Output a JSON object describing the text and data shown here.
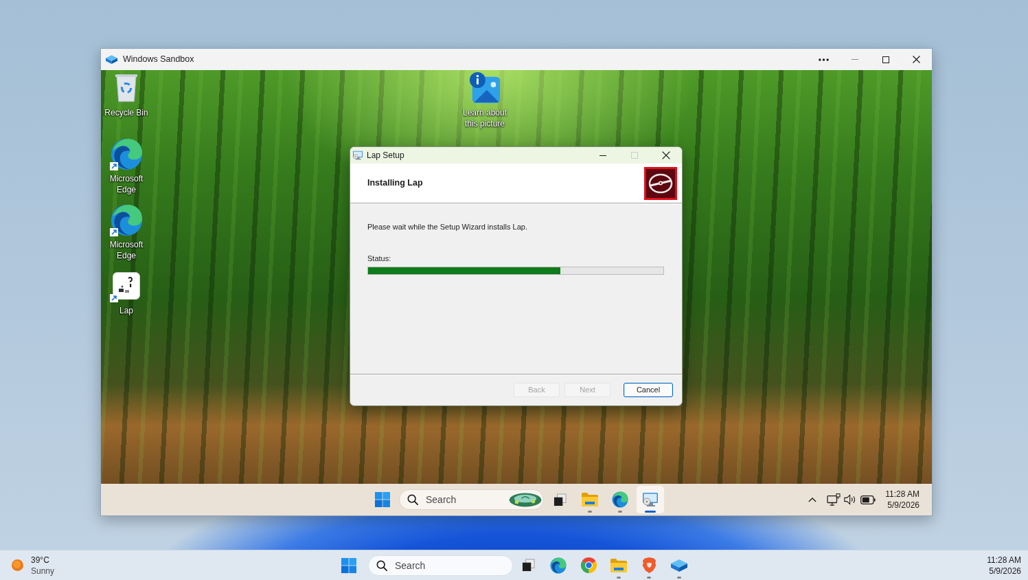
{
  "sandbox_window": {
    "title": "Windows Sandbox",
    "desktop_icons": [
      {
        "kind": "recycle-bin",
        "label": "Recycle Bin",
        "shortcut": false
      },
      {
        "kind": "edge",
        "label": "Microsoft Edge",
        "shortcut": true
      },
      {
        "kind": "edge",
        "label": "Microsoft Edge",
        "shortcut": true
      },
      {
        "kind": "lap",
        "label": "Lap",
        "shortcut": true
      }
    ],
    "spotlight_icon": {
      "label": "Learn about this picture"
    },
    "setup_dialog": {
      "title": "Lap Setup",
      "title_buttons": [
        {
          "kind": "minimize",
          "disabled": false
        },
        {
          "kind": "maximize",
          "disabled": true
        },
        {
          "kind": "close",
          "disabled": false
        }
      ],
      "heading": "Installing Lap",
      "message": "Please wait while the Setup Wizard installs Lap.",
      "status_label": "Status:",
      "progress": {
        "level": 0.65
      },
      "buttons": [
        {
          "label": "Back",
          "disabled": true,
          "default": false
        },
        {
          "label": "Next",
          "disabled": true,
          "default": false
        },
        {
          "label": "Cancel",
          "disabled": false,
          "default": true
        }
      ]
    },
    "taskbar": {
      "search": {
        "placeholder": "Search"
      },
      "apps": [
        {
          "kind": "task-view",
          "running": false,
          "selected": false
        },
        {
          "kind": "file-explorer",
          "running": true,
          "selected": false
        },
        {
          "kind": "edge",
          "running": true,
          "selected": false
        },
        {
          "kind": "setup",
          "running": true,
          "selected": true
        }
      ],
      "time": "11:28 AM",
      "date": "5/9/2026"
    }
  },
  "host_taskbar": {
    "weather": {
      "temperature": "39°C",
      "condition": "Sunny"
    },
    "search": {
      "placeholder": "Search"
    },
    "apps": [
      {
        "kind": "task-view",
        "running": false,
        "selected": false
      },
      {
        "kind": "edge",
        "running": false,
        "selected": false
      },
      {
        "kind": "chrome",
        "running": false,
        "selected": false
      },
      {
        "kind": "file-explorer",
        "running": true,
        "selected": false
      },
      {
        "kind": "brave",
        "running": true,
        "selected": false
      },
      {
        "kind": "sandbox",
        "running": true,
        "selected": false
      }
    ],
    "time": "11:28 AM",
    "date": "5/9/2026"
  }
}
